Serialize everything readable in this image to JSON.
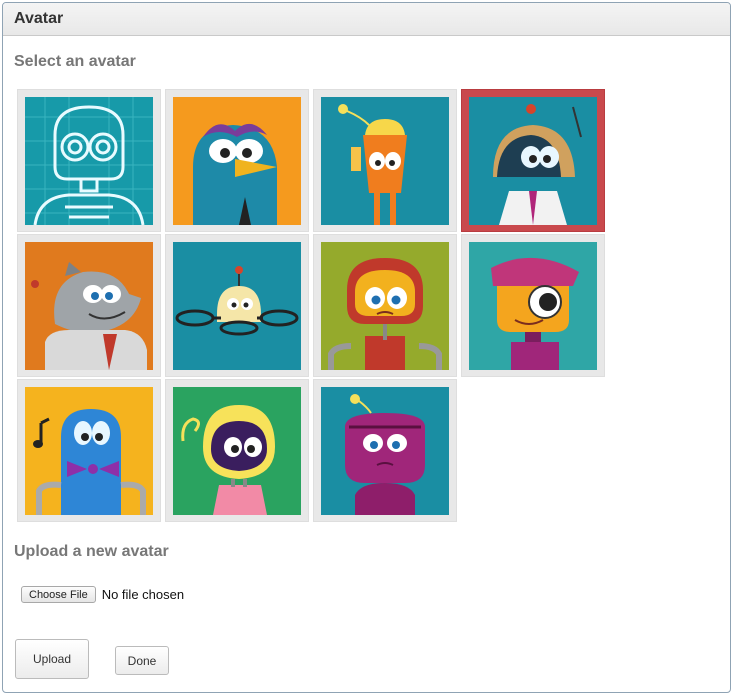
{
  "panel": {
    "title": "Avatar"
  },
  "select_section": {
    "title": "Select an avatar"
  },
  "avatars": [
    {
      "id": "robot-outline",
      "selected": false,
      "icon": "robot-outline-avatar-icon",
      "bg": "#179aa9"
    },
    {
      "id": "blue-bird",
      "selected": false,
      "icon": "blue-bird-avatar-icon",
      "bg": "#f59a1e"
    },
    {
      "id": "orange-antenna-bot",
      "selected": false,
      "icon": "orange-antenna-robot-avatar-icon",
      "bg": "#1a8ea3"
    },
    {
      "id": "helmet-scientist",
      "selected": true,
      "icon": "helmet-scientist-robot-avatar-icon",
      "bg": "#1a8ea3"
    },
    {
      "id": "gray-rhino-bot",
      "selected": false,
      "icon": "gray-rhino-robot-avatar-icon",
      "bg": "#e07a1e"
    },
    {
      "id": "drone-bot",
      "selected": false,
      "icon": "drone-robot-avatar-icon",
      "bg": "#1a8ea3"
    },
    {
      "id": "sad-red-bot",
      "selected": false,
      "icon": "sad-red-robot-avatar-icon",
      "bg": "#95aa2c"
    },
    {
      "id": "cyclops-bot",
      "selected": false,
      "icon": "cyclops-robot-avatar-icon",
      "bg": "#2fa6a6"
    },
    {
      "id": "music-blue-bot",
      "selected": false,
      "icon": "music-blue-robot-avatar-icon",
      "bg": "#f5b31e"
    },
    {
      "id": "purple-helmet-bot",
      "selected": false,
      "icon": "purple-helmet-robot-avatar-icon",
      "bg": "#2aa360"
    },
    {
      "id": "magenta-bot",
      "selected": false,
      "icon": "magenta-robot-avatar-icon",
      "bg": "#1a8ea3"
    }
  ],
  "upload_section": {
    "title": "Upload a new avatar",
    "choose_file_label": "Choose File",
    "file_status": "No file chosen"
  },
  "buttons": {
    "upload_label": "Upload",
    "done_label": "Done"
  },
  "colors": {
    "selected_border": "#c9494d",
    "tile_bg": "#e8e8e8",
    "panel_border": "#8fa3b4"
  }
}
